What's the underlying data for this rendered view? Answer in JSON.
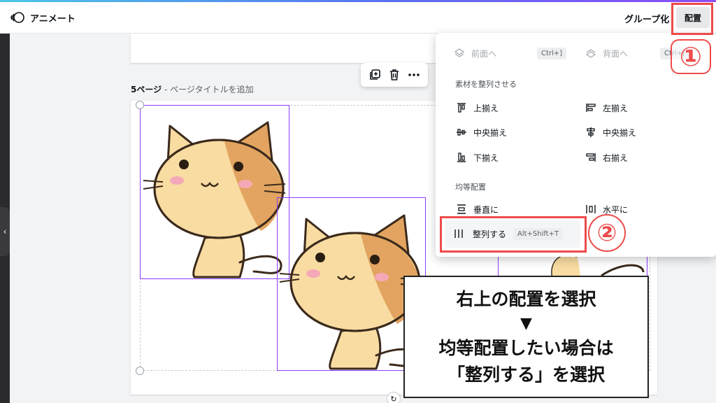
{
  "topbar": {
    "animate_label": "アニメート",
    "group_label": "グループ化",
    "arrange_label": "配置"
  },
  "annotations": {
    "step1": "①",
    "step2": "②"
  },
  "page": {
    "number_label": "5ページ",
    "separator": " - ",
    "title_placeholder": "ページタイトルを追加"
  },
  "dropdown": {
    "bring_forward": "前面へ",
    "bring_forward_shortcut": "Ctrl+]",
    "send_backward": "背面へ",
    "send_backward_shortcut": "Ctrl+[",
    "align_section": "素材を整列させる",
    "align_top": "上揃え",
    "align_left": "左揃え",
    "align_middle": "中央揃え",
    "align_center": "中央揃え",
    "align_bottom": "下揃え",
    "align_right": "右揃え",
    "spacing_section": "均等配置",
    "vertical": "垂直に",
    "horizontal": "水平に",
    "tidy_up": "整列する",
    "tidy_up_shortcut": "Alt+Shift+T"
  },
  "note": {
    "line1": "右上の配置を選択",
    "arrow": "▼",
    "line2": "均等配置したい場合は",
    "line3": "「整列する」を選択"
  },
  "colors": {
    "accent": "#8b3dff",
    "annotation_red": "#ee4b4b",
    "cat_fur": "#f8dca2",
    "cat_patch": "#e2a460"
  }
}
